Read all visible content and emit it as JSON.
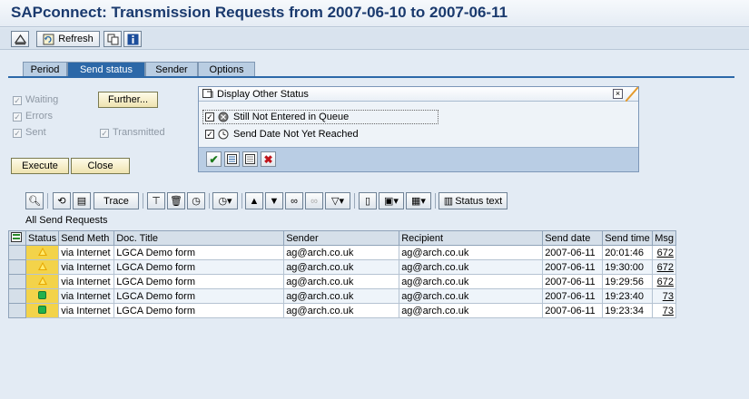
{
  "window": {
    "title": "SAPconnect: Transmission Requests from 2007-06-10 to 2007-06-11"
  },
  "toolbar": {
    "refresh_label": "Refresh"
  },
  "tabs": [
    {
      "label": "Period",
      "active": false
    },
    {
      "label": "Send status",
      "active": true
    },
    {
      "label": "Sender",
      "active": false
    },
    {
      "label": "Options",
      "active": false
    }
  ],
  "filters": {
    "waiting": {
      "label": "Waiting",
      "checked": true
    },
    "errors": {
      "label": "Errors",
      "checked": true
    },
    "sent": {
      "label": "Sent",
      "checked": true
    },
    "transmitted": {
      "label": "Transmitted",
      "checked": true
    },
    "further_label": "Further...",
    "execute_label": "Execute",
    "close_label": "Close"
  },
  "popup": {
    "title": "Display Other Status",
    "options": [
      {
        "label": "Still Not Entered in Queue",
        "checked": true
      },
      {
        "label": "Send Date Not Yet Reached",
        "checked": true
      }
    ]
  },
  "alv": {
    "trace_label": "Trace",
    "status_text_label": "Status text",
    "title": "All Send Requests"
  },
  "table": {
    "headers": [
      "Status",
      "Send Meth",
      "Doc. Title",
      "Sender",
      "Recipient",
      "Send date",
      "Send time",
      "Msg"
    ],
    "rows": [
      {
        "status": "warning",
        "method": "via Internet",
        "title": "LGCA Demo form",
        "sender": "ag@arch.co.uk",
        "recipient": "ag@arch.co.uk",
        "date": "2007-06-11",
        "time": "20:01:46",
        "msg": "672"
      },
      {
        "status": "warning",
        "method": "via Internet",
        "title": "LGCA Demo form",
        "sender": "ag@arch.co.uk",
        "recipient": "ag@arch.co.uk",
        "date": "2007-06-11",
        "time": "19:30:00",
        "msg": "672"
      },
      {
        "status": "warning",
        "method": "via Internet",
        "title": "LGCA Demo form",
        "sender": "ag@arch.co.uk",
        "recipient": "ag@arch.co.uk",
        "date": "2007-06-11",
        "time": "19:29:56",
        "msg": "672"
      },
      {
        "status": "ok",
        "method": "via Internet",
        "title": "LGCA Demo form",
        "sender": "ag@arch.co.uk",
        "recipient": "ag@arch.co.uk",
        "date": "2007-06-11",
        "time": "19:23:40",
        "msg": "73"
      },
      {
        "status": "ok",
        "method": "via Internet",
        "title": "LGCA Demo form",
        "sender": "ag@arch.co.uk",
        "recipient": "ag@arch.co.uk",
        "date": "2007-06-11",
        "time": "19:23:34",
        "msg": "73"
      }
    ]
  },
  "colors": {
    "accent": "#2c68a8",
    "warning": "#f3d34a",
    "ok": "#22b14c"
  }
}
